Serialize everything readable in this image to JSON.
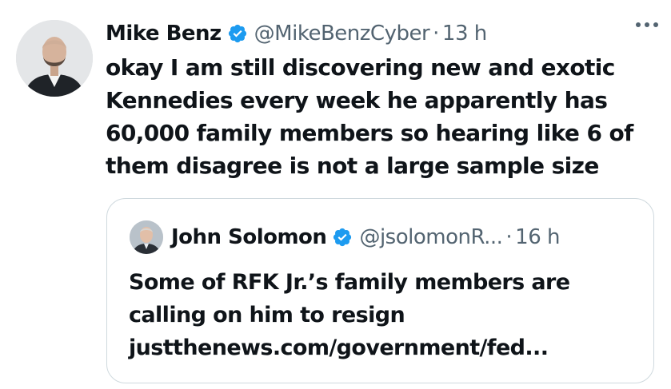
{
  "tweet": {
    "author_name": "Mike Benz",
    "handle": "@MikeBenzCyber",
    "separator": "·",
    "time": "13 h",
    "text": "okay I am still discovering new and exotic\nKennedies every week he apparently has\n60,000 family members so hearing like 6 of\nthem disagree is not a large sample size",
    "verified_color": "#1d9bf0",
    "more_icon": "ellipsis-icon"
  },
  "quote": {
    "author_name": "John Solomon",
    "handle": "@jsolomonR...",
    "separator": "·",
    "time": "16 h",
    "text": "Some of RFK Jr.’s family members are\ncalling on him to resign",
    "link": "justthenews.com/government/fed..."
  }
}
